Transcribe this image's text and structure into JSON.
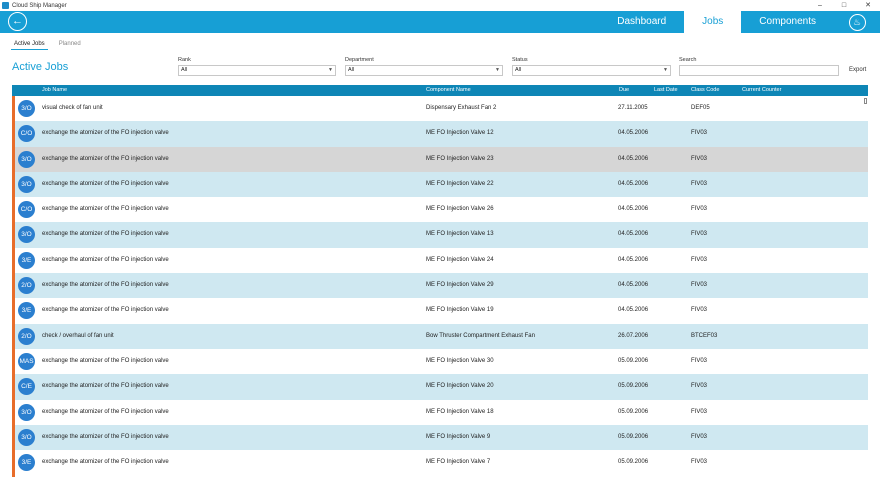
{
  "window": {
    "title": "Cloud Ship Manager"
  },
  "nav": {
    "tabs": [
      "Dashboard",
      "Jobs",
      "Components"
    ],
    "active": "Jobs"
  },
  "subtabs": [
    "Active Jobs",
    "Planned"
  ],
  "page_title": "Active Jobs",
  "filters": {
    "rank": {
      "label": "Rank",
      "value": "All"
    },
    "department": {
      "label": "Department",
      "value": "All"
    },
    "status": {
      "label": "Status",
      "value": "All"
    },
    "search": {
      "label": "Search",
      "value": ""
    }
  },
  "export_label": "Export",
  "columns": [
    "Job Name",
    "Component Name",
    "Due",
    "Last Date",
    "Class Code",
    "Current Counter"
  ],
  "rows": [
    {
      "rank": "3/O",
      "job": "visual check of fan unit",
      "component": "Dispensary Exhaust Fan 2",
      "due": "27.11.2005",
      "class_code": "DEF05"
    },
    {
      "rank": "C/O",
      "job": "exchange the atomizer of the FO injection valve",
      "component": "ME FO Injection Valve 12",
      "due": "04.05.2006",
      "class_code": "FIV03"
    },
    {
      "rank": "3/O",
      "job": "exchange the atomizer of the FO injection valve",
      "component": "ME FO Injection Valve 23",
      "due": "04.05.2006",
      "class_code": "FIV03"
    },
    {
      "rank": "3/O",
      "job": "exchange the atomizer of the FO injection valve",
      "component": "ME FO Injection Valve 22",
      "due": "04.05.2006",
      "class_code": "FIV03"
    },
    {
      "rank": "C/O",
      "job": "exchange the atomizer of the FO injection valve",
      "component": "ME FO Injection Valve 26",
      "due": "04.05.2006",
      "class_code": "FIV03"
    },
    {
      "rank": "3/O",
      "job": "exchange the atomizer of the FO injection valve",
      "component": "ME FO Injection Valve 13",
      "due": "04.05.2006",
      "class_code": "FIV03"
    },
    {
      "rank": "3/E",
      "job": "exchange the atomizer of the FO injection valve",
      "component": "ME FO Injection Valve 24",
      "due": "04.05.2006",
      "class_code": "FIV03"
    },
    {
      "rank": "2/O",
      "job": "exchange the atomizer of the FO injection valve",
      "component": "ME FO Injection Valve 29",
      "due": "04.05.2006",
      "class_code": "FIV03"
    },
    {
      "rank": "3/E",
      "job": "exchange the atomizer of the FO injection valve",
      "component": "ME FO Injection Valve 19",
      "due": "04.05.2006",
      "class_code": "FIV03"
    },
    {
      "rank": "2/O",
      "job": "check / overhaul of fan unit",
      "component": "Bow Thruster Compartment Exhaust Fan",
      "due": "26.07.2006",
      "class_code": "BTCEF03"
    },
    {
      "rank": "MAS",
      "job": "exchange the atomizer of the FO injection valve",
      "component": "ME FO Injection Valve 30",
      "due": "05.09.2006",
      "class_code": "FIV03"
    },
    {
      "rank": "C/E",
      "job": "exchange the atomizer of the FO injection valve",
      "component": "ME FO Injection Valve 20",
      "due": "05.09.2006",
      "class_code": "FIV03"
    },
    {
      "rank": "3/O",
      "job": "exchange the atomizer of the FO injection valve",
      "component": "ME FO Injection Valve 18",
      "due": "05.09.2006",
      "class_code": "FIV03"
    },
    {
      "rank": "3/O",
      "job": "exchange the atomizer of the FO injection valve",
      "component": "ME FO Injection Valve 9",
      "due": "05.09.2006",
      "class_code": "FIV03"
    },
    {
      "rank": "3/E",
      "job": "exchange the atomizer of the FO injection valve",
      "component": "ME FO Injection Valve 7",
      "due": "05.09.2006",
      "class_code": "FIV03"
    }
  ],
  "selected_row": 2,
  "colors": {
    "accent": "#179fd5",
    "header": "#0e86b6",
    "row_alt": "#cfe8f1",
    "row_selected": "#d6d6d6",
    "status_strip": "#e86d2a",
    "badge": "#2b7fcf"
  },
  "icons": {
    "back": "arrow-left-icon",
    "bell": "bell-icon",
    "app": "app-icon",
    "dropdown": "chevron-down-icon"
  }
}
